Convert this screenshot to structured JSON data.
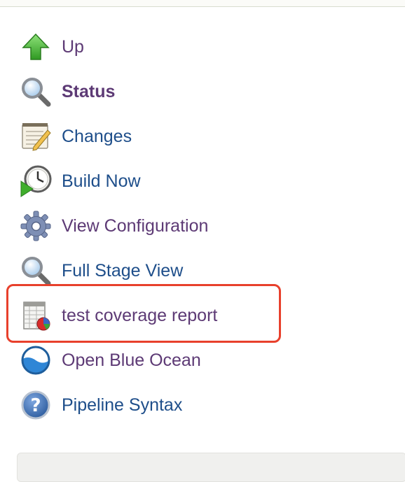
{
  "sidebar": {
    "items": [
      {
        "label": "Up",
        "icon": "up-arrow-icon"
      },
      {
        "label": "Status",
        "icon": "search-icon"
      },
      {
        "label": "Changes",
        "icon": "notepad-icon"
      },
      {
        "label": "Build Now",
        "icon": "clock-play-icon"
      },
      {
        "label": "View Configuration",
        "icon": "gear-icon"
      },
      {
        "label": "Full Stage View",
        "icon": "search-icon"
      },
      {
        "label": "test coverage report",
        "icon": "report-chart-icon"
      },
      {
        "label": "Open Blue Ocean",
        "icon": "blue-ocean-icon"
      },
      {
        "label": "Pipeline Syntax",
        "icon": "help-icon"
      }
    ]
  },
  "colors": {
    "link": "#1e4e8a",
    "visited_link": "#5d3a75",
    "highlight": "#e8402c"
  }
}
